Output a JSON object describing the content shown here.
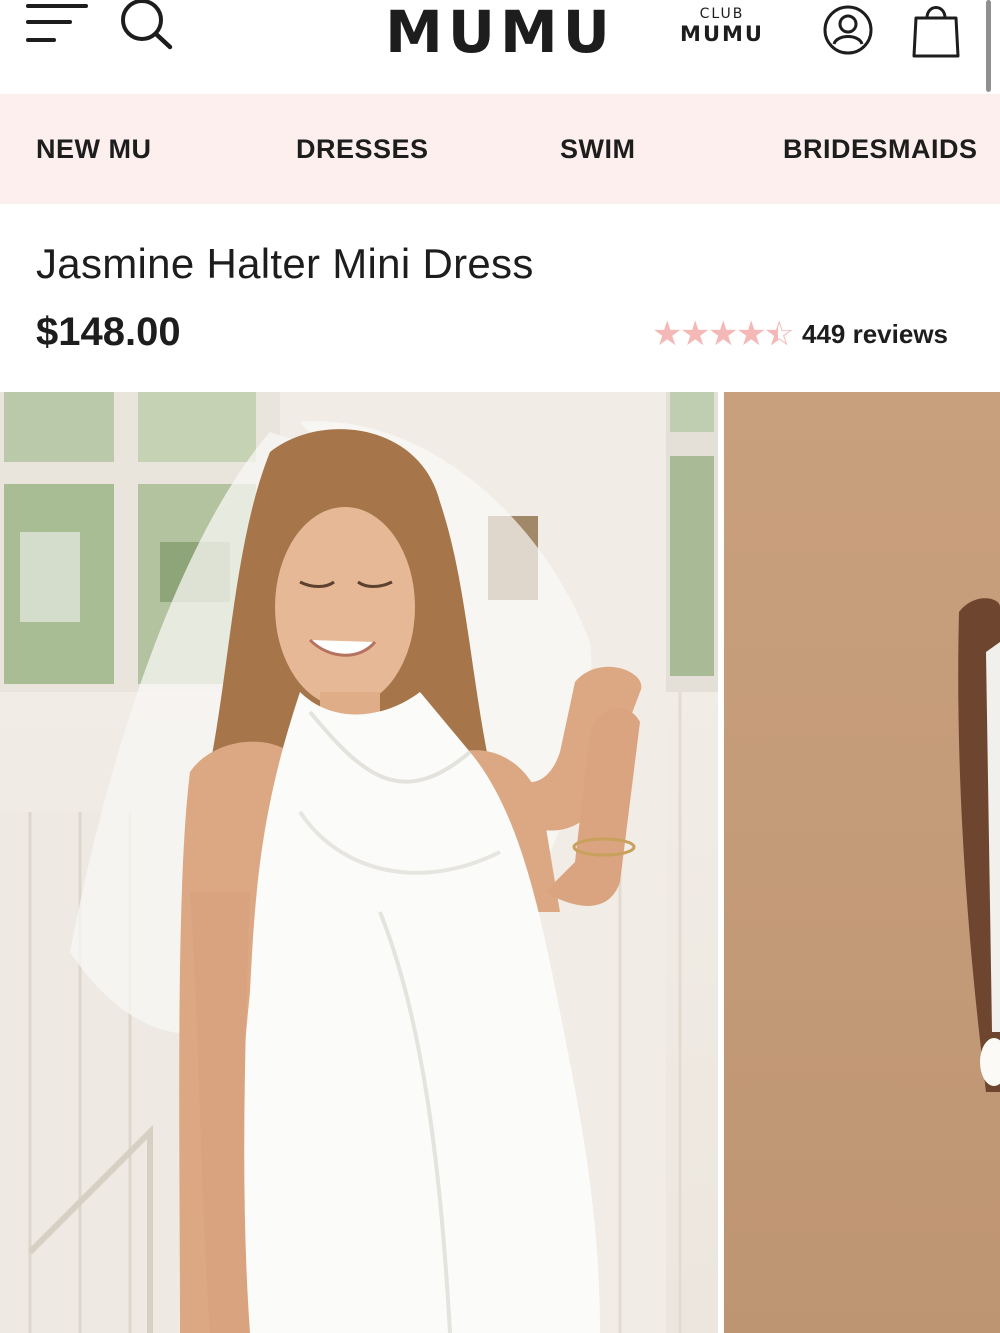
{
  "header": {
    "logo": "MUMU",
    "club_line1": "CLUB",
    "club_line2": "MUMU"
  },
  "nav": {
    "items": [
      "NEW MU",
      "DRESSES",
      "SWIM",
      "BRIDESMAIDS"
    ]
  },
  "product": {
    "title": "Jasmine Halter Mini Dress",
    "price": "$148.00",
    "rating": 4.5,
    "rating_max": 5,
    "reviews_label": "449 reviews"
  },
  "colors": {
    "nav_background": "#fcefee",
    "star": "#f4b8b6",
    "text": "#1d1d1d"
  },
  "icons": [
    "menu-icon",
    "search-icon",
    "account-icon",
    "shopping-bag-icon",
    "star-icon"
  ]
}
